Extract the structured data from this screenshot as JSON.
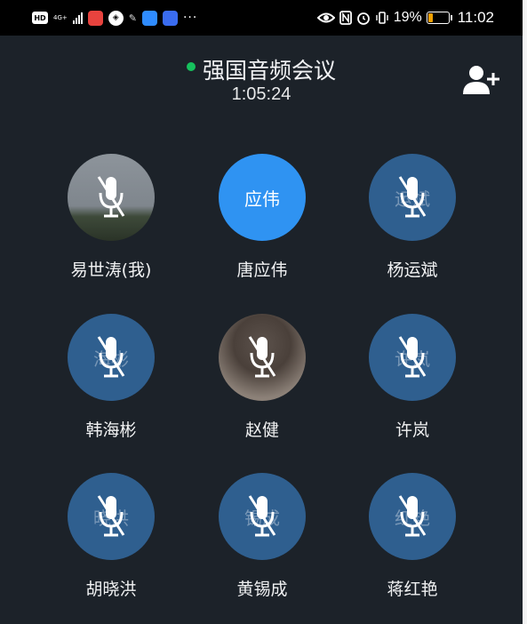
{
  "status_bar": {
    "hd": "HD",
    "network": "4G+",
    "battery_percent": "19%",
    "time": "11:02",
    "overflow": "···"
  },
  "meeting": {
    "title": "强国音频会议",
    "duration": "1:05:24"
  },
  "colors": {
    "background": "#1c2229",
    "avatar": "#2f5f8f",
    "speaking": "#2f93f2",
    "online": "#16c15d"
  },
  "participants": [
    {
      "name": "易世涛(我)",
      "avatar_text": "",
      "muted": true,
      "avatar_type": "photo"
    },
    {
      "name": "唐应伟",
      "avatar_text": "应伟",
      "muted": false,
      "avatar_type": "speaking"
    },
    {
      "name": "杨运斌",
      "avatar_text": "运斌",
      "muted": true,
      "avatar_type": "text"
    },
    {
      "name": "韩海彬",
      "avatar_text": "海彬",
      "muted": true,
      "avatar_type": "text"
    },
    {
      "name": "赵健",
      "avatar_text": "",
      "muted": true,
      "avatar_type": "photo"
    },
    {
      "name": "许岚",
      "avatar_text": "许岚",
      "muted": true,
      "avatar_type": "text"
    },
    {
      "name": "胡晓洪",
      "avatar_text": "晓洪",
      "muted": true,
      "avatar_type": "text"
    },
    {
      "name": "黄锡成",
      "avatar_text": "锡成",
      "muted": true,
      "avatar_type": "text"
    },
    {
      "name": "蒋红艳",
      "avatar_text": "红艳",
      "muted": true,
      "avatar_type": "text"
    }
  ],
  "icons": {
    "add_user": "add-user-icon",
    "muted": "muted-mic-icon"
  }
}
